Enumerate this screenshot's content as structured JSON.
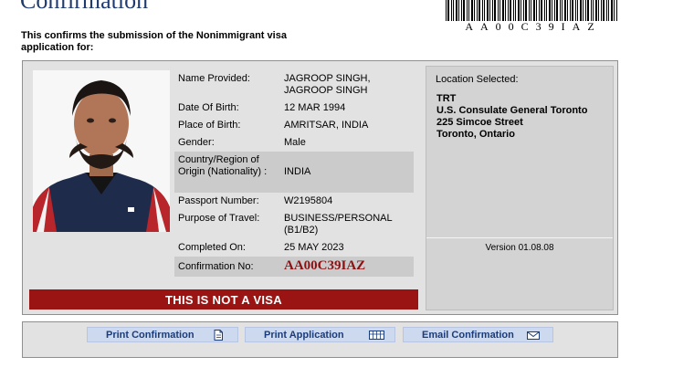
{
  "page": {
    "title": "Confirmation",
    "intro": "This confirms the submission of the Nonimmigrant visa application for:"
  },
  "barcode": {
    "text": "AA00C39IAZ"
  },
  "applicant": {
    "fields": [
      {
        "label": "Name Provided:",
        "value": "JAGROOP SINGH,\nJAGROOP SINGH"
      },
      {
        "label": "Date Of Birth:",
        "value": "12 MAR 1994"
      },
      {
        "label": "Place of Birth:",
        "value": "AMRITSAR, INDIA"
      },
      {
        "label": "Gender:",
        "value": "Male"
      },
      {
        "label": "Country/Region of Origin (Nationality) :",
        "value": "INDIA"
      },
      {
        "label": "Passport Number:",
        "value": "W2195804"
      },
      {
        "label": "Purpose of Travel:",
        "value": "BUSINESS/PERSONAL (B1/B2)"
      },
      {
        "label": "Completed On:",
        "value": "25 MAY 2023"
      }
    ],
    "confirmation": {
      "label": "Confirmation No:",
      "value": "AA00C39IAZ"
    }
  },
  "notice": "THIS IS NOT A VISA",
  "location": {
    "heading": "Location Selected:",
    "code": "TRT",
    "office": "U.S. Consulate General Toronto",
    "street": "225 Simcoe Street",
    "city": "Toronto, Ontario"
  },
  "version": "Version 01.08.08",
  "actions": {
    "print_confirmation": "Print Confirmation",
    "print_application": "Print Application",
    "email_confirmation": "Email Confirmation"
  },
  "icons": {
    "print_confirmation": "document-icon",
    "print_application": "print-grid-icon",
    "email_confirmation": "envelope-icon"
  },
  "colors": {
    "title": "#1f3a6e",
    "notice_bar": "#9a1414",
    "confirmation_number": "#8b1214",
    "button_bg": "#cdd9ef",
    "button_text": "#1b3c7a",
    "panel_bg": "#e2e2e2"
  }
}
